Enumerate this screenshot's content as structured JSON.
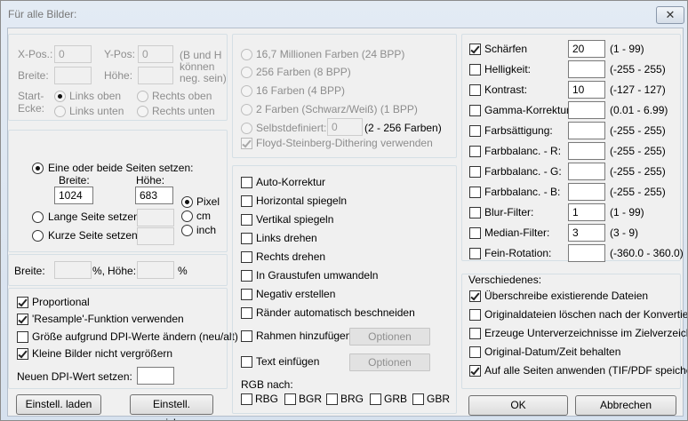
{
  "window": {
    "title": "Für alle Bilder:",
    "close_symbol": "✕"
  },
  "position": {
    "xpos_label": "X-Pos.:",
    "xpos_value": "0",
    "ypos_label": "Y-Pos:",
    "ypos_value": "0",
    "hint_line1": "(B und H",
    "hint_line2": "können",
    "hint_line3": "neg. sein)",
    "breite_label": "Breite:",
    "breite_value": "",
    "hoehe_label": "Höhe:",
    "hoehe_value": "",
    "corner_label_line1": "Start-",
    "corner_label_line2": "Ecke:",
    "corner_tl": "Links oben",
    "corner_tr": "Rechts oben",
    "corner_bl": "Links unten",
    "corner_br": "Rechts unten"
  },
  "resize": {
    "option_both": "Eine oder beide Seiten setzen:",
    "width_label": "Breite:",
    "width_value": "1024",
    "height_label": "Höhe:",
    "height_value": "683",
    "unit_pixel": "Pixel",
    "unit_cm": "cm",
    "unit_inch": "inch",
    "option_long": "Lange Seite setzen:",
    "long_value": "",
    "option_short": "Kurze Seite setzen:",
    "short_value": ""
  },
  "percent": {
    "breite_label": "Breite:",
    "breite_value": "",
    "pct1": "%,",
    "hoehe_label": "Höhe:",
    "hoehe_value": "",
    "pct2": "%"
  },
  "options_left": {
    "proportional": "Proportional",
    "resample": "'Resample'-Funktion verwenden",
    "dpi_change": "Größe aufgrund DPI-Werte ändern (neu/alt)",
    "no_enlarge": "Kleine Bilder nicht vergrößern",
    "new_dpi_label": "Neuen DPI-Wert setzen:",
    "new_dpi_value": ""
  },
  "buttons": {
    "load": "Einstell. laden",
    "save": "Einstell. speichern",
    "ok": "OK",
    "cancel": "Abbrechen"
  },
  "colors": {
    "c24": "16,7 Millionen Farben (24 BPP)",
    "c256": "256 Farben (8 BPP)",
    "c16": "16 Farben (4 BPP)",
    "c2": "2 Farben (Schwarz/Weiß) (1 BPP)",
    "custom": "Selbstdefiniert:",
    "custom_value": "0",
    "custom_range": "(2 - 256 Farben)",
    "dither": "Floyd-Steinberg-Dithering verwenden"
  },
  "transform": {
    "auto": "Auto-Korrektur",
    "hflip": "Horizontal spiegeln",
    "vflip": "Vertikal spiegeln",
    "rotl": "Links drehen",
    "rotr": "Rechts drehen",
    "gray": "In Graustufen umwandeln",
    "neg": "Negativ erstellen",
    "crop": "Ränder automatisch beschneiden",
    "frame": "Rahmen hinzufügen",
    "text": "Text einfügen",
    "options_btn": "Optionen",
    "rgb_label": "RGB nach:",
    "rgb_opts": [
      "RBG",
      "BGR",
      "BRG",
      "GRB",
      "GBR"
    ]
  },
  "adjust": [
    {
      "label": "Schärfen",
      "value": "20",
      "range": "(1  -  99)",
      "checked": true
    },
    {
      "label": "Helligkeit:",
      "value": "",
      "range": "(-255  -  255)",
      "checked": false
    },
    {
      "label": "Kontrast:",
      "value": "10",
      "range": "(-127  -  127)",
      "checked": false
    },
    {
      "label": "Gamma-Korrektur:",
      "value": "",
      "range": "(0.01  -  6.99)",
      "checked": false
    },
    {
      "label": "Farbsättigung:",
      "value": "",
      "range": "(-255  -  255)",
      "checked": false
    },
    {
      "label": "Farbbalanc. - R:",
      "value": "",
      "range": "(-255  -  255)",
      "checked": false
    },
    {
      "label": "Farbbalanc. - G:",
      "value": "",
      "range": "(-255  -  255)",
      "checked": false
    },
    {
      "label": "Farbbalanc. - B:",
      "value": "",
      "range": "(-255  -  255)",
      "checked": false
    },
    {
      "label": "Blur-Filter:",
      "value": "1",
      "range": "(1  -  99)",
      "checked": false
    },
    {
      "label": "Median-Filter:",
      "value": "3",
      "range": "(3  -  9)",
      "checked": false
    },
    {
      "label": "Fein-Rotation:",
      "value": "",
      "range": "(-360.0  -  360.0)",
      "checked": false
    }
  ],
  "misc": {
    "title": "Verschiedenes:",
    "overwrite": "Überschreibe existierende Dateien",
    "delete_orig": "Originaldateien löschen nach der Konvertier.",
    "subdirs": "Erzeuge Unterverzeichnisse im Zielverzeichn.",
    "keep_date": "Original-Datum/Zeit behalten",
    "all_pages": "Auf alle Seiten anwenden (TIF/PDF speichern)"
  }
}
